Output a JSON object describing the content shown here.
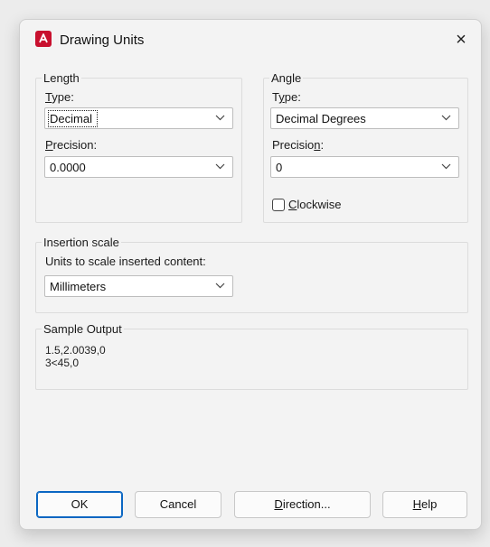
{
  "window": {
    "title": "Drawing Units",
    "app_icon_letter": "A",
    "close_glyph": "×"
  },
  "length": {
    "legend": "Length",
    "type_label_prefix": "",
    "type_label_key": "T",
    "type_label_rest": "ype:",
    "type_value": "Decimal",
    "precision_label_key": "P",
    "precision_label_rest": "recision:",
    "precision_value": "0.0000"
  },
  "angle": {
    "legend": "Angle",
    "type_label_prefix": "T",
    "type_label_key": "y",
    "type_label_rest": "pe:",
    "type_value": "Decimal Degrees",
    "precision_label_prefix": "Precisio",
    "precision_label_key": "n",
    "precision_label_rest": ":",
    "precision_value": "0",
    "clockwise_key": "C",
    "clockwise_rest": "lockwise",
    "clockwise_checked": false
  },
  "insertion": {
    "legend": "Insertion scale",
    "label": "Units to scale inserted content:",
    "value": "Millimeters"
  },
  "sample": {
    "legend": "Sample Output",
    "line1": "1.5,2.0039,0",
    "line2": "3<45,0"
  },
  "buttons": {
    "ok": "OK",
    "cancel": "Cancel",
    "direction_key": "D",
    "direction_rest": "irection...",
    "help_key": "H",
    "help_rest": "elp"
  },
  "colors": {
    "accent": "#0a66c2",
    "app_icon": "#c8102e"
  }
}
